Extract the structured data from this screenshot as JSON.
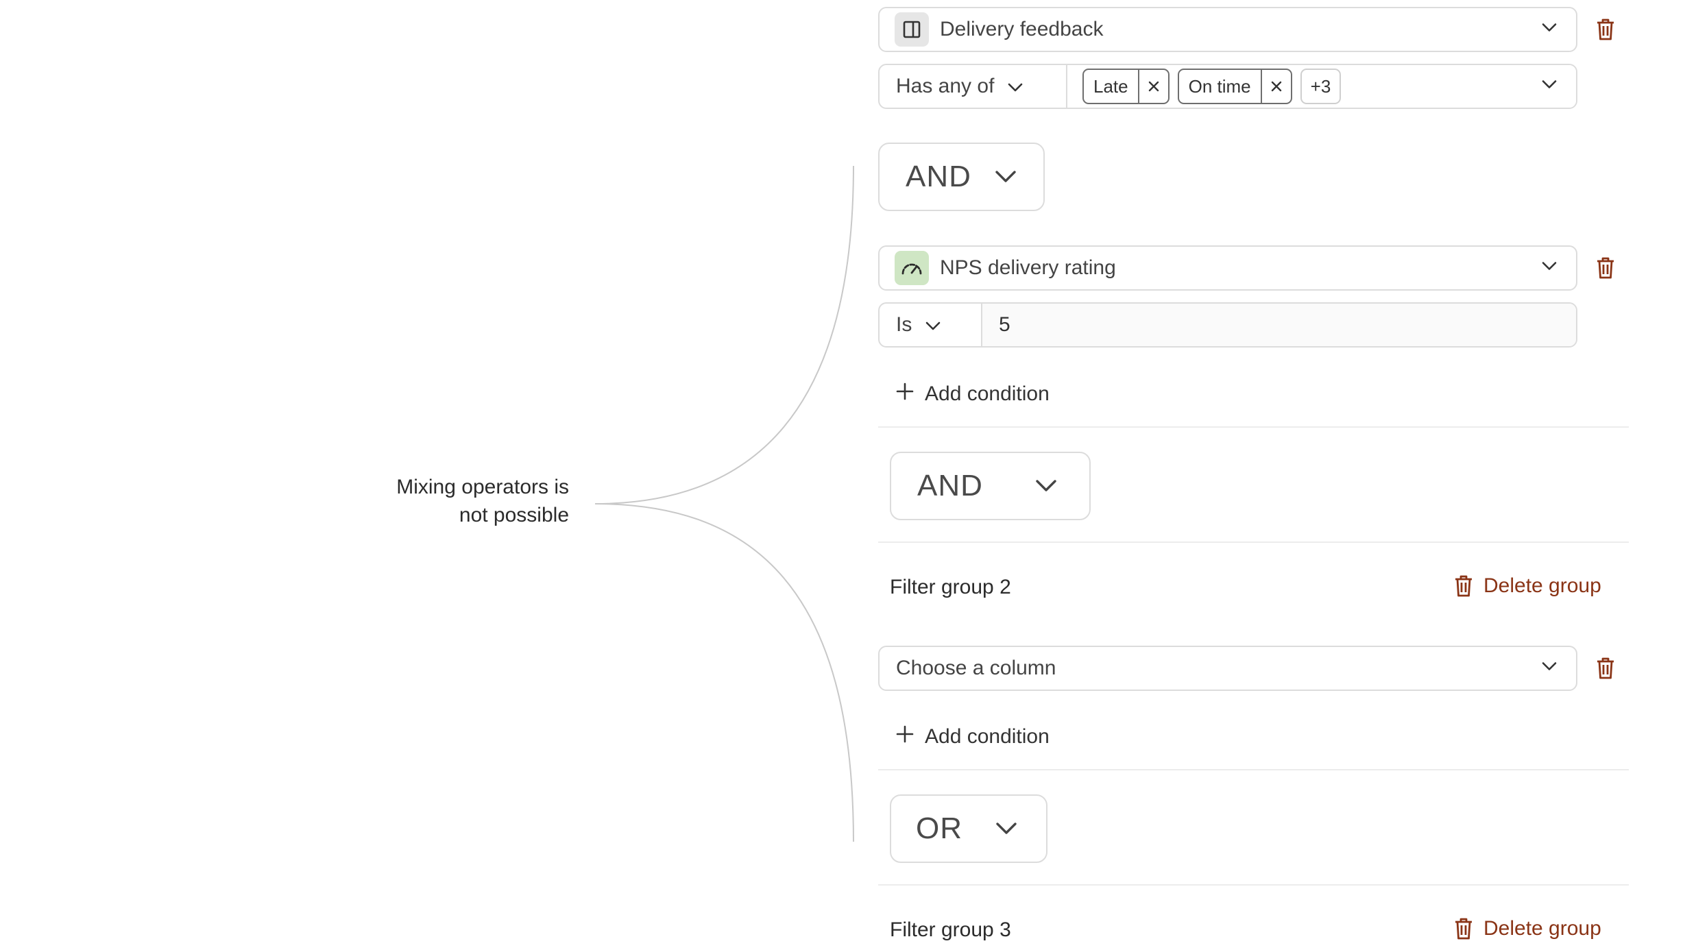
{
  "annotation": {
    "line1": "Mixing operators is",
    "line2": "not possible"
  },
  "group1": {
    "condition1": {
      "column": "Delivery feedback",
      "operator": "Has any of",
      "chips": [
        "Late",
        "On time"
      ],
      "more": "+3"
    },
    "logic1": "AND",
    "condition2": {
      "column": "NPS delivery rating",
      "operator": "Is",
      "value": "5"
    },
    "add_condition": "Add condition"
  },
  "between_groups_logic_1": "AND",
  "group2": {
    "title": "Filter group 2",
    "delete_label": "Delete group",
    "column_placeholder": "Choose a column",
    "add_condition": "Add condition"
  },
  "between_groups_logic_2": "OR",
  "group3": {
    "title": "Filter group 3",
    "delete_label": "Delete group"
  },
  "colors": {
    "danger": "#8a3416",
    "border": "#dcdcdc",
    "nps_icon_bg": "#cfe6c4",
    "annotation_line": "#c8c8c8"
  },
  "icons": {
    "column_text": "panel-icon",
    "column_rating": "gauge-icon",
    "delete": "trash-icon",
    "dropdown": "chevron-down-icon",
    "add": "plus-icon",
    "remove_chip": "close-icon"
  }
}
